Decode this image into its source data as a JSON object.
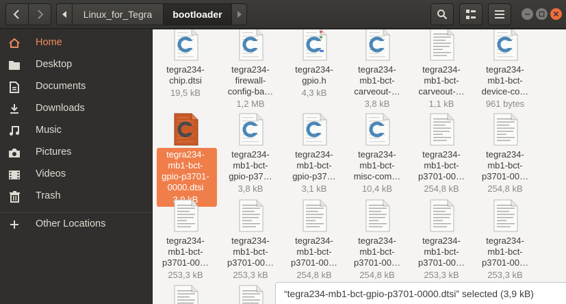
{
  "header": {
    "path": [
      "Linux_for_Tegra",
      "bootloader"
    ]
  },
  "sidebar": {
    "items": [
      {
        "label": "Home",
        "icon": "home-icon",
        "active": true
      },
      {
        "label": "Desktop",
        "icon": "desktop-folder-icon"
      },
      {
        "label": "Documents",
        "icon": "documents-icon"
      },
      {
        "label": "Downloads",
        "icon": "downloads-icon"
      },
      {
        "label": "Music",
        "icon": "music-icon"
      },
      {
        "label": "Pictures",
        "icon": "camera-icon"
      },
      {
        "label": "Videos",
        "icon": "videos-icon"
      },
      {
        "label": "Trash",
        "icon": "trash-icon"
      },
      {
        "label": "Other Locations",
        "icon": "plus-icon"
      }
    ]
  },
  "files": [
    {
      "name": "tegra234-\nchip.dtsi",
      "size": "19,5 kB",
      "type": "c"
    },
    {
      "name": "tegra234-\nfirewall-\nconfig-ba…",
      "size": "1,2 MB",
      "type": "c"
    },
    {
      "name": "tegra234-\ngpio.h",
      "size": "4,3 kB",
      "type": "h"
    },
    {
      "name": "tegra234-\nmb1-bct-\ncarveout-…",
      "size": "3,8 kB",
      "type": "c"
    },
    {
      "name": "tegra234-\nmb1-bct-\ncarveout-…",
      "size": "1,1 kB",
      "type": "text"
    },
    {
      "name": "tegra234-\nmb1-bct-\ndevice-co…",
      "size": "961 bytes",
      "type": "c"
    },
    {
      "name": "tegra234-\nmb1-bct-\ngpio-p3701-\n0000.dtsi",
      "size": "3,9 kB",
      "type": "c",
      "selected": true
    },
    {
      "name": "tegra234-\nmb1-bct-\ngpio-p37…",
      "size": "3,8 kB",
      "type": "c"
    },
    {
      "name": "tegra234-\nmb1-bct-\ngpio-p37…",
      "size": "3,1 kB",
      "type": "c"
    },
    {
      "name": "tegra234-\nmb1-bct-\nmisc-com…",
      "size": "10,4 kB",
      "type": "c"
    },
    {
      "name": "tegra234-\nmb1-bct-\np3701-00…",
      "size": "254,8 kB",
      "type": "text"
    },
    {
      "name": "tegra234-\nmb1-bct-\np3701-00…",
      "size": "254,8 kB",
      "type": "text"
    },
    {
      "name": "tegra234-\nmb1-bct-\np3701-00…",
      "size": "253,3 kB",
      "type": "text"
    },
    {
      "name": "tegra234-\nmb1-bct-\np3701-00…",
      "size": "253,3 kB",
      "type": "text"
    },
    {
      "name": "tegra234-\nmb1-bct-\np3701-00…",
      "size": "254,8 kB",
      "type": "text"
    },
    {
      "name": "tegra234-\nmb1-bct-\np3701-00…",
      "size": "254,8 kB",
      "type": "text"
    },
    {
      "name": "tegra234-\nmb1-bct-\np3701-00…",
      "size": "253,3 kB",
      "type": "text"
    },
    {
      "name": "tegra234-\nmb1-bct-\np3701-00…",
      "size": "253,3 kB",
      "type": "text"
    },
    {
      "name": "",
      "size": "",
      "type": "text"
    },
    {
      "name": "",
      "size": "",
      "type": "text"
    }
  ],
  "status": {
    "text": "“tegra234-mb1-bct-gpio-p3701-0000.dtsi” selected  (3,9 kB)"
  },
  "colors": {
    "accent": "#ef7e4b",
    "c_icon": "#4b87b8",
    "header": "#3a3935",
    "sidebar": "#302f2d"
  }
}
